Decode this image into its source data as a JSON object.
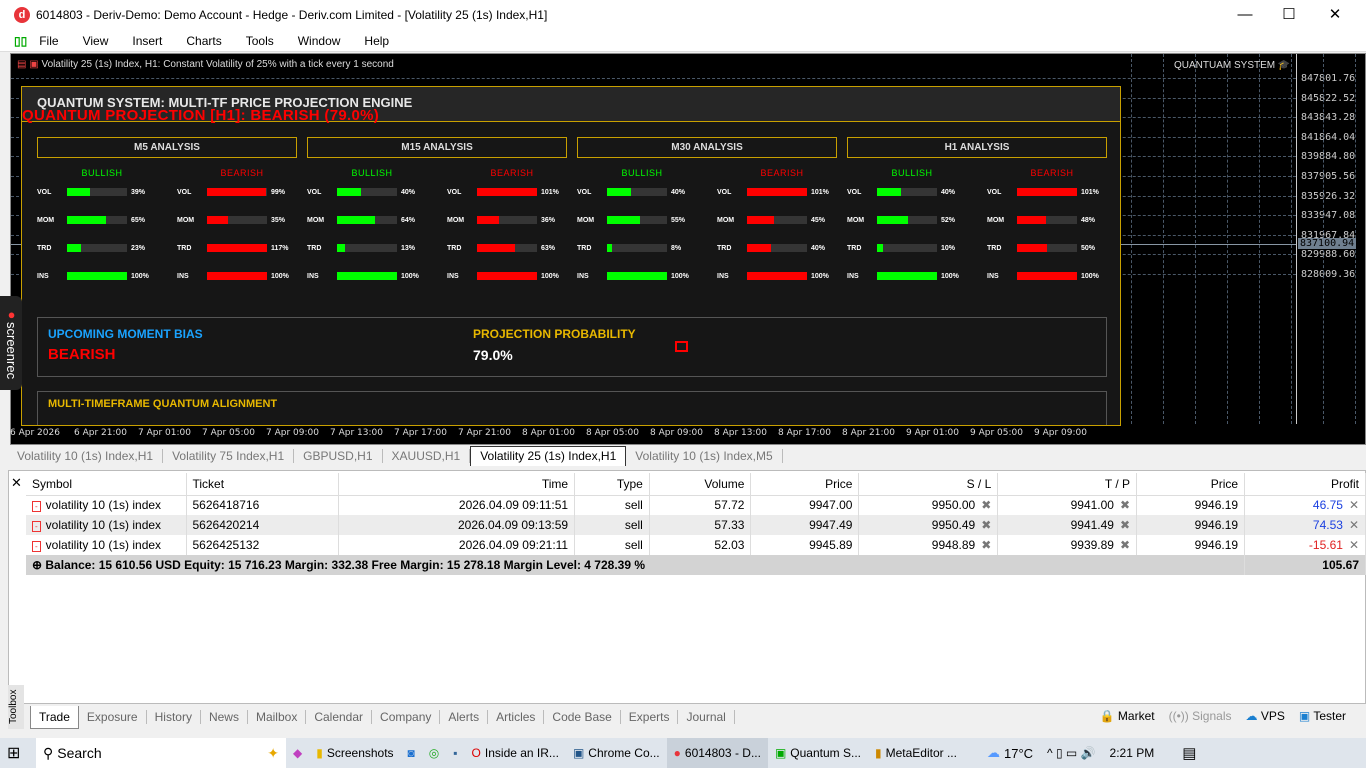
{
  "window": {
    "title": "6014803 - Deriv-Demo: Demo Account - Hedge - Deriv.com Limited - [Volatility 25 (1s) Index,H1]",
    "app_icon": "d",
    "minimize": "—",
    "maximize": "☐",
    "close": "✕"
  },
  "menu": [
    "File",
    "View",
    "Insert",
    "Charts",
    "Tools",
    "Window",
    "Help"
  ],
  "chart": {
    "header": "Volatility 25 (1s) Index, H1:  Constant Volatility of 25% with a tick every 1 second",
    "brand": "QUANTUAM SYSTEM",
    "current_price": "837100.94",
    "price_labels": [
      "847801.76",
      "845822.52",
      "843843.28",
      "841864.04",
      "839884.80",
      "837905.56",
      "835926.32",
      "833947.08",
      "831967.84",
      "829988.60",
      "828009.36"
    ],
    "time_labels": [
      "6 Apr 2026",
      "6 Apr 21:00",
      "7 Apr 01:00",
      "7 Apr 05:00",
      "7 Apr 09:00",
      "7 Apr 13:00",
      "7 Apr 17:00",
      "7 Apr 21:00",
      "8 Apr 01:00",
      "8 Apr 05:00",
      "8 Apr 09:00",
      "8 Apr 13:00",
      "8 Apr 17:00",
      "8 Apr 21:00",
      "9 Apr 01:00",
      "9 Apr 05:00",
      "9 Apr 09:00"
    ]
  },
  "panel": {
    "title": "QUANTUM SYSTEM: MULTI-TF PRICE PROJECTION ENGINE",
    "projection": "QUANTUM PROJECTION [H1]: BEARISH (79.0%)",
    "bullish_label": "BULLISH",
    "bearish_label": "BEARISH",
    "colors": {
      "bullish": "#00ff00",
      "bearish": "#ff0000",
      "accent": "#c8a000"
    },
    "timeframes": [
      {
        "title": "M5 ANALYSIS",
        "bullish": [
          {
            "label": "VOL",
            "value": 39
          },
          {
            "label": "MOM",
            "value": 65
          },
          {
            "label": "TRD",
            "value": 23
          },
          {
            "label": "INS",
            "value": 100
          }
        ],
        "bearish": [
          {
            "label": "VOL",
            "value": 99
          },
          {
            "label": "MOM",
            "value": 35
          },
          {
            "label": "TRD",
            "value": 117
          },
          {
            "label": "INS",
            "value": 100
          }
        ]
      },
      {
        "title": "M15 ANALYSIS",
        "bullish": [
          {
            "label": "VOL",
            "value": 40
          },
          {
            "label": "MOM",
            "value": 64
          },
          {
            "label": "TRD",
            "value": 13
          },
          {
            "label": "INS",
            "value": 100
          }
        ],
        "bearish": [
          {
            "label": "VOL",
            "value": 101
          },
          {
            "label": "MOM",
            "value": 36
          },
          {
            "label": "TRD",
            "value": 63
          },
          {
            "label": "INS",
            "value": 100
          }
        ]
      },
      {
        "title": "M30 ANALYSIS",
        "bullish": [
          {
            "label": "VOL",
            "value": 40
          },
          {
            "label": "MOM",
            "value": 55
          },
          {
            "label": "TRD",
            "value": 8
          },
          {
            "label": "INS",
            "value": 100
          }
        ],
        "bearish": [
          {
            "label": "VOL",
            "value": 101
          },
          {
            "label": "MOM",
            "value": 45
          },
          {
            "label": "TRD",
            "value": 40
          },
          {
            "label": "INS",
            "value": 100
          }
        ]
      },
      {
        "title": "H1 ANALYSIS",
        "bullish": [
          {
            "label": "VOL",
            "value": 40
          },
          {
            "label": "MOM",
            "value": 52
          },
          {
            "label": "TRD",
            "value": 10
          },
          {
            "label": "INS",
            "value": 100
          }
        ],
        "bearish": [
          {
            "label": "VOL",
            "value": 101
          },
          {
            "label": "MOM",
            "value": 48
          },
          {
            "label": "TRD",
            "value": 50
          },
          {
            "label": "INS",
            "value": 100
          }
        ]
      }
    ],
    "bias_label": "UPCOMING MOMENT BIAS",
    "bias_value": "BEARISH",
    "prob_label": "PROJECTION PROBABILITY",
    "prob_value": "79.0%",
    "alignment_label": "MULTI-TIMEFRAME QUANTUM ALIGNMENT"
  },
  "chart_tabs": [
    {
      "label": "Volatility 10 (1s) Index,H1"
    },
    {
      "label": "Volatility 75 Index,H1"
    },
    {
      "label": "GBPUSD,H1"
    },
    {
      "label": "XAUUSD,H1"
    },
    {
      "label": "Volatility 25 (1s) Index,H1",
      "active": true
    },
    {
      "label": "Volatility 10 (1s) Index,M5"
    }
  ],
  "trade": {
    "columns": [
      "Symbol",
      "Ticket",
      "Time",
      "Type",
      "Volume",
      "Price",
      "S / L",
      "T / P",
      "Price",
      "Profit"
    ],
    "rows": [
      {
        "symbol": "volatility 10 (1s) index",
        "ticket": "5626418716",
        "time": "2026.04.09 09:11:51",
        "type": "sell",
        "volume": "57.72",
        "price": "9947.00",
        "sl": "9950.00",
        "tp": "9941.00",
        "cur": "9946.19",
        "profit": "46.75",
        "pos": true
      },
      {
        "symbol": "volatility 10 (1s) index",
        "ticket": "5626420214",
        "time": "2026.04.09 09:13:59",
        "type": "sell",
        "volume": "57.33",
        "price": "9947.49",
        "sl": "9950.49",
        "tp": "9941.49",
        "cur": "9946.19",
        "profit": "74.53",
        "pos": true
      },
      {
        "symbol": "volatility 10 (1s) index",
        "ticket": "5626425132",
        "time": "2026.04.09 09:21:11",
        "type": "sell",
        "volume": "52.03",
        "price": "9945.89",
        "sl": "9948.89",
        "tp": "9939.89",
        "cur": "9946.19",
        "profit": "-15.61",
        "pos": false
      }
    ],
    "summary": "Balance: 15 610.56 USD  Equity: 15 716.23  Margin: 332.38  Free Margin: 15 278.18  Margin Level: 4 728.39 %",
    "total_profit": "105.67"
  },
  "bottom_tabs": [
    "Trade",
    "Exposure",
    "History",
    "News",
    "Mailbox",
    "Calendar",
    "Company",
    "Alerts",
    "Articles",
    "Code Base",
    "Experts",
    "Journal"
  ],
  "toolbox_label": "Toolbox",
  "right_tools": [
    "Market",
    "Signals",
    "VPS",
    "Tester"
  ],
  "screenrec": "screenrec",
  "taskbar": {
    "search": "Search",
    "apps": [
      "Screenshots",
      "Inside an IR...",
      "Chrome Co...",
      "6014803 - D...",
      "Quantum S...",
      "MetaEditor ..."
    ],
    "weather": "17°C",
    "time": "2:21 PM"
  }
}
